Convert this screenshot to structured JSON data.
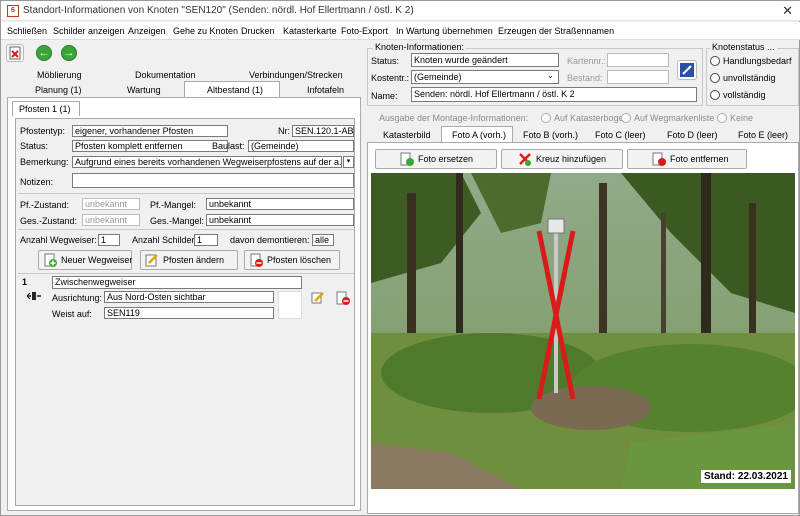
{
  "window": {
    "title": "Standort-Informationen von Knoten \"SEN120\" (Senden: nördl. Hof Ellertmann / östl. K 2)",
    "icon_text": "6",
    "close_glyph": "✕"
  },
  "menu": [
    "Schließen",
    "Schilder anzeigen",
    "Anzeigen",
    "Gehe zu Knoten",
    "Drucken",
    "Katasterkarte",
    "Foto-Export",
    "In Wartung übernehmen",
    "Erzeugen der Straßennamen"
  ],
  "left_tabs": {
    "row1": [
      "Möblierung",
      "Dokumentation",
      "Verbindungen/Strecken"
    ],
    "row2": [
      "Planung (1)",
      "Wartung",
      "Altbestand (1)",
      "Infotafeln"
    ],
    "active": "Altbestand (1)"
  },
  "pfosten_tab": "Pfosten 1 (1)",
  "pfosten": {
    "typ_label": "Pfostentyp:",
    "typ_value": "eigener, vorhandener Pfosten",
    "nr_label": "Nr:",
    "nr_value": "SEN.120.1-AB",
    "status_label": "Status:",
    "status_value": "Pfosten komplett entfernen",
    "baulast_label": "Baulast:",
    "baulast_value": "(Gemeinde)",
    "bemerkung_label": "Bemerkung:",
    "bemerkung_value": "Aufgrund eines bereits vorhandenen Wegweiserpfostens auf der a...",
    "notizen_label": "Notizen:",
    "notizen_value": "",
    "pf_zustand_label": "Pf.-Zustand:",
    "pf_zustand_value": "unbekannt",
    "pf_mangel_label": "Pf.-Mangel:",
    "pf_mangel_value": "unbekannt",
    "ges_zustand_label": "Ges.-Zustand:",
    "ges_zustand_value": "unbekannt",
    "ges_mangel_label": "Ges.-Mangel:",
    "ges_mangel_value": "unbekannt",
    "anz_wegweiser_label": "Anzahl Wegweiser:",
    "anz_wegweiser_value": "1",
    "anz_schilder_label": "Anzahl Schilder:",
    "anz_schilder_value": "1",
    "demontiert_label": "davon demontieren:",
    "demontiert_value": "alle"
  },
  "pfosten_buttons": {
    "neu": "Neuer Wegweiser",
    "aendern": "Pfosten ändern",
    "loeschen": "Pfosten löschen"
  },
  "wegweiser": {
    "index": "1",
    "name": "Zwischenwegweiser",
    "ausrichtung_label": "Ausrichtung:",
    "ausrichtung_value": "Aus Nord-Osten sichtbar",
    "weist_label": "Weist auf:",
    "weist_value": "SEN119"
  },
  "knoten": {
    "group_label": "Knoten-Informationen:",
    "status_label": "Status:",
    "status_value": "Knoten wurde geändert",
    "kartennr_label": "Kartennr.:",
    "kartennr_value": "",
    "kostentr_label": "Kostentr.:",
    "kostentr_value": "(Gemeinde)",
    "bestand_label": "Bestand:",
    "bestand_value": "",
    "name_label": "Name:",
    "name_value": "Senden: nördl. Hof Ellertmann / östl. K 2"
  },
  "knotenstatus": {
    "label": "Knotenstatus ...",
    "options": [
      "Handlungsbedarf",
      "unvollständig",
      "vollständig"
    ]
  },
  "montage": {
    "label": "Ausgabe der Montage-Informationen:",
    "options": [
      "Auf Katasterbogen",
      "Auf Wegmarkenliste",
      "Keine"
    ]
  },
  "foto_tabs": [
    "Katasterbild",
    "Foto A (vorh.)",
    "Foto B (vorh.)",
    "Foto C (leer)",
    "Foto D (leer)",
    "Foto E (leer)"
  ],
  "foto_active": "Foto A (vorh.)",
  "foto_buttons": {
    "ersetzen": "Foto ersetzen",
    "kreuz": "Kreuz hinzufügen",
    "entfernen": "Foto entfernen"
  },
  "photo": {
    "stamp": "Stand: 22.03.2021",
    "marker": "red-cross-marker"
  },
  "colors": {
    "green_icon": "#3aa63a",
    "red_cross": "#d81c1c",
    "tab_active_bg": "#ffffff"
  }
}
